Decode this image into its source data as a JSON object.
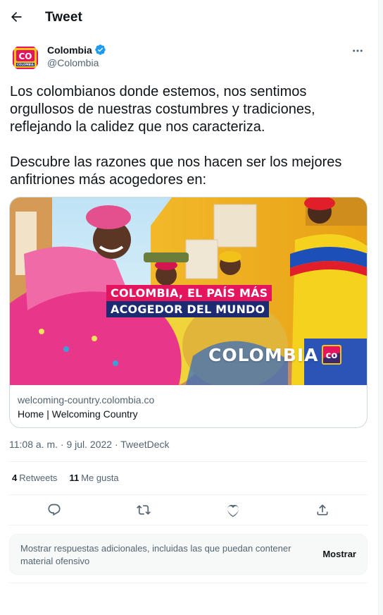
{
  "header": {
    "title": "Tweet"
  },
  "author": {
    "display_name": "Colombia",
    "handle": "@Colombia",
    "verified": true,
    "avatar_text": "CO",
    "avatar_subtext": "COLOMBIA"
  },
  "tweet": {
    "text": "Los colombianos donde estemos, nos sentimos orgullosos de nuestras costumbres y tradiciones, reflejando la calidez que nos caracteriza.\n\nDescubre las razones que nos hacen ser los mejores anfitriones más acogedores en:"
  },
  "card": {
    "banner_line1": "COLOMBIA, EL PAÍS MÁS",
    "banner_line2": "ACOGEDOR DEL MUNDO",
    "brand_text": "COLOMBIA",
    "brand_badge": "co",
    "domain": "welcoming-country.colombia.co",
    "title": "Home | Welcoming Country"
  },
  "meta": {
    "time": "11:08 a. m.",
    "sep1": " · ",
    "date": "9 jul. 2022",
    "sep2": " · ",
    "source": "TweetDeck"
  },
  "stats": {
    "retweets_count": "4",
    "retweets_label": "Retweets",
    "likes_count": "11",
    "likes_label": "Me gusta"
  },
  "actions": [
    "reply-icon",
    "retweet-icon",
    "like-icon",
    "share-icon"
  ],
  "more_replies": {
    "text": "Mostrar respuestas adicionales, incluidas las que puedan contener material ofensivo",
    "button": "Mostrar"
  },
  "colors": {
    "verified": "#1d9bf0",
    "banner_pink": "#e4145e",
    "banner_navy": "#1d2b73",
    "text": "#0f1419",
    "secondary": "#536471"
  }
}
